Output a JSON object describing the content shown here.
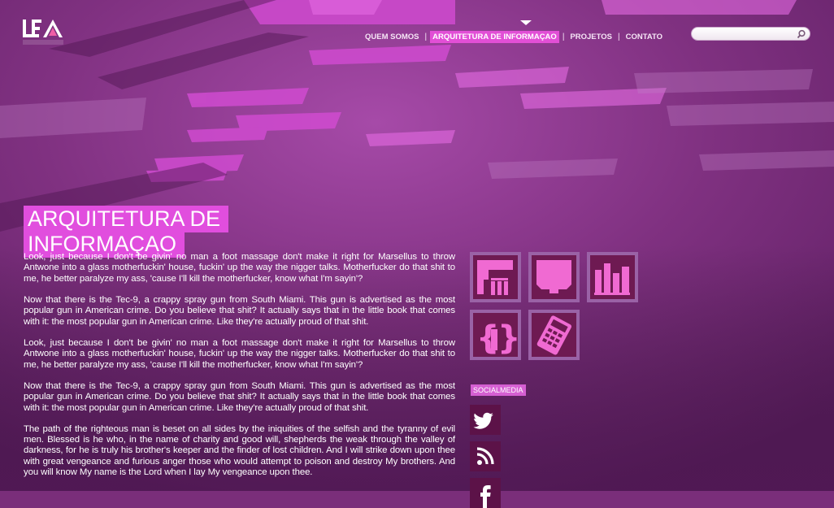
{
  "nav": {
    "items": [
      {
        "label": "QUEM SOMOS",
        "active": false
      },
      {
        "label": "ARQUITETURA DE INFORMAÇAO",
        "active": true
      },
      {
        "label": "PROJETOS",
        "active": false
      },
      {
        "label": "CONTATO",
        "active": false
      }
    ],
    "separator": "|"
  },
  "search": {
    "placeholder": "",
    "value": ""
  },
  "page": {
    "title": "ARQUITETURA DE INFORMAÇAO",
    "paragraphs": [
      "Look, just because I don't be givin' no man a foot massage don't make it right for Marsellus to throw Antwone into a glass motherfuckin' house, fuckin' up the way the nigger talks. Motherfucker do that shit to me, he better paralyze my ass, 'cause I'll kill the motherfucker, know what I'm sayin'?",
      "Now that there is the Tec-9, a crappy spray gun from South Miami. This gun is advertised as the most popular gun in American crime. Do you believe that shit? It actually says that in the little book that comes with it: the most popular gun in American crime. Like they're actually proud of that shit.",
      "Look, just because I don't be givin' no man a foot massage don't make it right for Marsellus to throw Antwone into a glass motherfuckin' house, fuckin' up the way the nigger talks. Motherfucker do that shit to me, he better paralyze my ass, 'cause I'll kill the motherfucker, know what I'm sayin'?",
      "Now that there is the Tec-9, a crappy spray gun from South Miami. This gun is advertised as the most popular gun in American crime. Do you believe that shit? It actually says that in the little book that comes with it: the most popular gun in American crime. Like they're actually proud of that shit.",
      "The path of the righteous man is beset on all sides by the iniquities of the selfish and the tyranny of evil men. Blessed is he who, in the name of charity and good will, shepherds the weak through the valley of darkness, for he is truly his brother's keeper and the finder of lost children. And I will strike down upon thee with great vengeance and furious anger those who would attempt to poison and destroy My brothers. And you will know My name is the Lord when I lay My vengeance upon thee."
    ]
  },
  "tiles": [
    {
      "icon": "sitemap-icon"
    },
    {
      "icon": "monitor-icon"
    },
    {
      "icon": "bar-chart-icon"
    },
    {
      "icon": "code-braces-icon"
    },
    {
      "icon": "calculator-icon"
    }
  ],
  "social": {
    "label": "SOCIALMEDIA",
    "items": [
      {
        "icon": "twitter-icon"
      },
      {
        "icon": "rss-icon"
      },
      {
        "icon": "facebook-icon"
      }
    ]
  },
  "colors": {
    "accent": "#e24fd6",
    "background": "#7a2e7a",
    "tile_dark": "#6e1a52",
    "icon_pink": "#f06ad2"
  }
}
